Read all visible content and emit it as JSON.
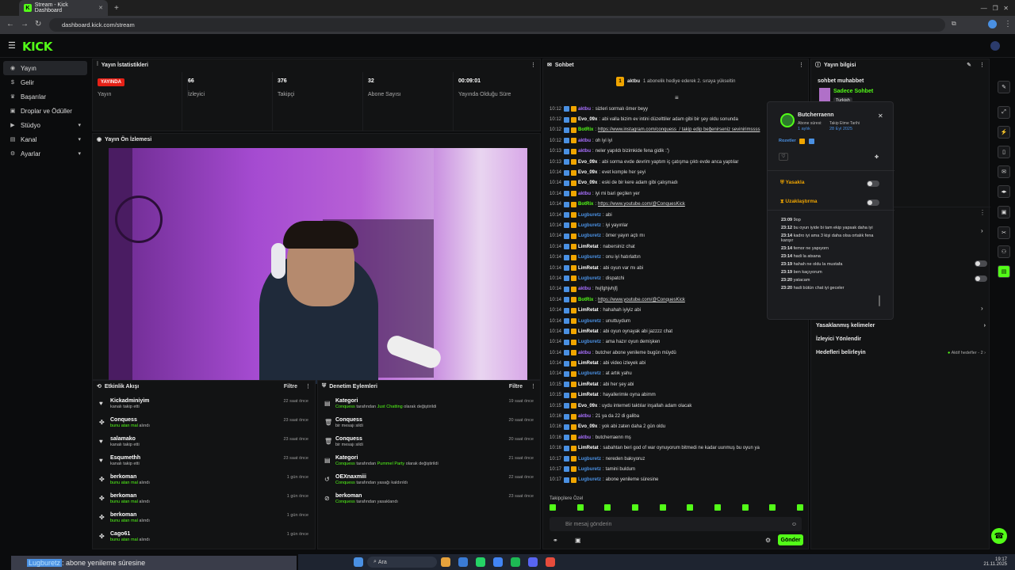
{
  "browser": {
    "tab_title": "Stream - Kick Dashboard",
    "url": "dashboard.kick.com/stream"
  },
  "logo": "KICK",
  "sidebar": {
    "items": [
      {
        "label": "Yayın",
        "icon": "broadcast-icon"
      },
      {
        "label": "Gelir",
        "icon": "dollar-icon"
      },
      {
        "label": "Başarılar",
        "icon": "trophy-icon"
      },
      {
        "label": "Droplar ve Ödüller",
        "icon": "gift-icon"
      },
      {
        "label": "Stüdyo",
        "icon": "video-icon"
      },
      {
        "label": "Kanal",
        "icon": "channel-icon"
      },
      {
        "label": "Ayarlar",
        "icon": "gear-icon"
      }
    ]
  },
  "stats": {
    "title": "Yayın İstatistikleri",
    "live_badge": "YAYINDA",
    "live_label": "Yayın",
    "viewers": "66",
    "viewers_label": "İzleyici",
    "followers": "376",
    "followers_label": "Takipçi",
    "subs": "32",
    "subs_label": "Abone Sayısı",
    "duration": "00:09:01",
    "duration_label": "Yayında Olduğu Süre"
  },
  "preview": {
    "title": "Yayın Ön İzlemesi"
  },
  "activity": {
    "title": "Etkinlik Akışı",
    "filter": "Filtre",
    "items": [
      {
        "name": "Kickadminiyim",
        "sub": "kanalı takip etti",
        "time": "22 saat önce",
        "icon": "heart-icon"
      },
      {
        "name": "Conquess",
        "sub": "bunu atan mal",
        "sub2": "alındı",
        "time": "23 saat önce",
        "icon": "gift-icon"
      },
      {
        "name": "salamako",
        "sub": "kanalı takip etti",
        "time": "23 saat önce",
        "icon": "heart-icon"
      },
      {
        "name": "Esqumethh",
        "sub": "kanalı takip etti",
        "time": "23 saat önce",
        "icon": "heart-icon"
      },
      {
        "name": "berkoman",
        "sub": "bunu atan mal",
        "sub2": "alındı",
        "time": "1 gün önce",
        "icon": "gift-icon"
      },
      {
        "name": "berkoman",
        "sub": "bunu atan mal",
        "sub2": "alındı",
        "time": "1 gün önce",
        "icon": "gift-icon"
      },
      {
        "name": "berkoman",
        "sub": "bunu atan mal",
        "sub2": "alındı",
        "time": "1 gün önce",
        "icon": "gift-icon"
      },
      {
        "name": "Cago61",
        "sub": "bunu atan mal",
        "sub2": "alındı",
        "time": "1 gün önce",
        "icon": "gift-icon"
      }
    ]
  },
  "mod": {
    "title": "Denetim Eylemleri",
    "filter": "Filtre",
    "items": [
      {
        "name": "Kategori",
        "who": "Conquess",
        "mid": "tarafından",
        "hl": "Just Chatting",
        "rest": "olarak değiştirildi",
        "time": "19 saat önce",
        "icon": "category-icon"
      },
      {
        "name": "Conquess",
        "who": "",
        "mid": "",
        "hl": "",
        "rest": "bir mesajı sildi",
        "time": "20 saat önce",
        "icon": "trash-icon"
      },
      {
        "name": "Conquess",
        "who": "",
        "mid": "",
        "hl": "",
        "rest": "bir mesajı sildi",
        "time": "20 saat önce",
        "icon": "trash-icon"
      },
      {
        "name": "Kategori",
        "who": "Conquess",
        "mid": "tarafından",
        "hl": "Pummel Party",
        "rest": "olarak değiştirildi",
        "time": "21 saat önce",
        "icon": "category-icon"
      },
      {
        "name": "OEXnaxmiii",
        "who": "Conquess",
        "mid": "tarafından yasağı kaldırıldı",
        "hl": "",
        "rest": "",
        "time": "22 saat önce",
        "icon": "unban-icon"
      },
      {
        "name": "berkoman",
        "who": "Conquess",
        "mid": "tarafından yasaklandı",
        "hl": "",
        "rest": "",
        "time": "23 saat önce",
        "icon": "ban-icon"
      }
    ]
  },
  "chat": {
    "title": "Sohbet",
    "pinned_user": "aktbu",
    "pinned_msg": "1 abonelik hediye ederek 2. sıraya yükseltin",
    "lines": [
      {
        "t": "10:12",
        "u": "aktbu",
        "c": "#a970ff",
        "m": "sizleri sormalı ömer beyy"
      },
      {
        "t": "10:12",
        "u": "Evo_09x",
        "c": "#ffffff",
        "m": "abi valla bizim ev intini düzelttiler adam gibi bir şey oldu sonunda"
      },
      {
        "t": "10:12",
        "u": "BotRix",
        "c": "#53fc18",
        "m": "https://www.instagram.com/conquess_/ takip edip beğenirseniz sevinirimssss",
        "link": true
      },
      {
        "t": "10:12",
        "u": "aktbu",
        "c": "#a970ff",
        "m": "oh iyi iyi"
      },
      {
        "t": "10:13",
        "u": "aktbu",
        "c": "#a970ff",
        "m": "neler yapıldı bizimkide fena gidik :')"
      },
      {
        "t": "10:13",
        "u": "Evo_09x",
        "c": "#ffffff",
        "m": "abi sorma evde devrim yaptım iç çatışma çıktı evde anca yaptılar"
      },
      {
        "t": "10:14",
        "u": "Evo_09x",
        "c": "#ffffff",
        "m": "evet komple her şeyi"
      },
      {
        "t": "10:14",
        "u": "Evo_09x",
        "c": "#ffffff",
        "m": "eski de bir kere adam gibi çalışmadı"
      },
      {
        "t": "10:14",
        "u": "aktbu",
        "c": "#a970ff",
        "m": "iyi mi bari geçilen yer"
      },
      {
        "t": "10:14",
        "u": "BotRix",
        "c": "#53fc18",
        "m": "https://www.youtube.com/@ConquesKick",
        "link": true
      },
      {
        "t": "10:14",
        "u": "Lugburetz",
        "c": "#4a90e2",
        "m": "abi"
      },
      {
        "t": "10:14",
        "u": "Lugburetz",
        "c": "#4a90e2",
        "m": "iyi yayınlar"
      },
      {
        "t": "10:14",
        "u": "Lugburetz",
        "c": "#4a90e2",
        "m": "ömer yayın açtı mı"
      },
      {
        "t": "10:14",
        "u": "LimRetat",
        "c": "#ffffff",
        "m": "nabersiniz chat"
      },
      {
        "t": "10:14",
        "u": "Lugburetz",
        "c": "#4a90e2",
        "m": "onu iyi hatırlattın"
      },
      {
        "t": "10:14",
        "u": "LimRetat",
        "c": "#ffffff",
        "m": "abi oyun var mı abi"
      },
      {
        "t": "10:14",
        "u": "Lugburetz",
        "c": "#4a90e2",
        "m": "dispatchi"
      },
      {
        "t": "10:14",
        "u": "aktbu",
        "c": "#a970ff",
        "m": "hvjfghjvhjfj"
      },
      {
        "t": "10:14",
        "u": "BotRix",
        "c": "#53fc18",
        "m": "https://www.youtube.com/@ConquesKick",
        "link": true
      },
      {
        "t": "10:14",
        "u": "LimRetat",
        "c": "#ffffff",
        "m": "hahahah iyiyiz abi"
      },
      {
        "t": "10:14",
        "u": "Lugburetz",
        "c": "#4a90e2",
        "m": "unuttuydum"
      },
      {
        "t": "10:14",
        "u": "LimRetat",
        "c": "#ffffff",
        "m": "abi oyun oynayak abi jazzzz chat"
      },
      {
        "t": "10:14",
        "u": "Lugburetz",
        "c": "#4a90e2",
        "m": "ama hazır oyun demişken"
      },
      {
        "t": "10:14",
        "u": "aktbu",
        "c": "#a970ff",
        "m": "butcher abone yenileme bugün müydü"
      },
      {
        "t": "10:14",
        "u": "LimRetat",
        "c": "#ffffff",
        "m": "abi video izleyek abi"
      },
      {
        "t": "10:14",
        "u": "Lugburetz",
        "c": "#4a90e2",
        "m": "at artık yahu"
      },
      {
        "t": "10:15",
        "u": "LimRetat",
        "c": "#ffffff",
        "m": "abi her şey abi"
      },
      {
        "t": "10:15",
        "u": "LimRetat",
        "c": "#ffffff",
        "m": "hayallerimle oyna abimm"
      },
      {
        "t": "10:15",
        "u": "Evo_09x",
        "c": "#ffffff",
        "m": "uydu interneti taktılar inşallah adam olacak"
      },
      {
        "t": "10:16",
        "u": "aktbu",
        "c": "#a970ff",
        "m": "21 ya da 22 di galiba"
      },
      {
        "t": "10:16",
        "u": "Evo_09x",
        "c": "#ffffff",
        "m": "yok abi zaten daha 2 gün oldu"
      },
      {
        "t": "10:16",
        "u": "aktbu",
        "c": "#a970ff",
        "m": "butcherraenn mş"
      },
      {
        "t": "10:16",
        "u": "LimRetat",
        "c": "#ffffff",
        "m": "sabahtan beri god of war oynuyorum bitmedi ne kadar uunmuş bu oyun ya"
      },
      {
        "t": "10:17",
        "u": "Lugburetz",
        "c": "#4a90e2",
        "m": "nereden bakıyoruz"
      },
      {
        "t": "10:17",
        "u": "Lugburetz",
        "c": "#4a90e2",
        "m": "tamini buldum"
      },
      {
        "t": "10:17",
        "u": "Lugburetz",
        "c": "#4a90e2",
        "m": "abone yenileme süresine"
      }
    ],
    "followers_only": "Takipçilere Özel",
    "placeholder": "Bir mesaj gönderin",
    "send": "Gönder"
  },
  "info": {
    "title": "Yayın bilgisi",
    "stream_title": "sohbet muhabbet",
    "category": "Sadece Sohbet",
    "lang": "Turkish"
  },
  "usercard": {
    "name": "Butcherraenn",
    "sub_label": "Abone süresi:",
    "sub_value": "1 aylık",
    "follow_label": "Takip Etme Tarihi",
    "follow_value": "28 Eyl 2025",
    "badges_label": "Rozetler",
    "ban": "Yasakla",
    "timeout": "Uzaklaştırma",
    "history": [
      {
        "t": "23:09",
        "m": "9op"
      },
      {
        "t": "23:12",
        "m": "bu oyun iyide bi tam ekip yapsak daha iyi"
      },
      {
        "t": "23:14",
        "m": "kadro iyi ama 3 kişi daha olsa ortalık fena karışır"
      },
      {
        "t": "23:14",
        "m": "femor ne yapıyorn"
      },
      {
        "t": "23:14",
        "m": "hadi la atsana"
      },
      {
        "t": "23:19",
        "m": "hahah ne oldu la mustafa"
      },
      {
        "t": "23:19",
        "m": "ben kaçıyorum"
      },
      {
        "t": "23:20",
        "m": "yatacam"
      },
      {
        "t": "23:20",
        "m": "hadi bütün chat iyi geceler"
      }
    ]
  },
  "settings": {
    "items": [
      {
        "label": "Yasaklanmış kelimeler",
        "right": ""
      },
      {
        "label": "İzleyici Yönlendir",
        "right": ""
      },
      {
        "label": "Hedefleri belirleyin",
        "right": "Aktif hedefler - 2"
      }
    ]
  },
  "taskbar": {
    "search": "Ara",
    "time": "19:17",
    "date": "21.11.2025"
  },
  "caption": {
    "user": "Lugburetz",
    "text": ": abone yenileme süresine"
  },
  "colors": {
    "accent": "#53fc18",
    "bg": "#0b0c0d",
    "panel": "#121314",
    "live": "#e62117"
  }
}
